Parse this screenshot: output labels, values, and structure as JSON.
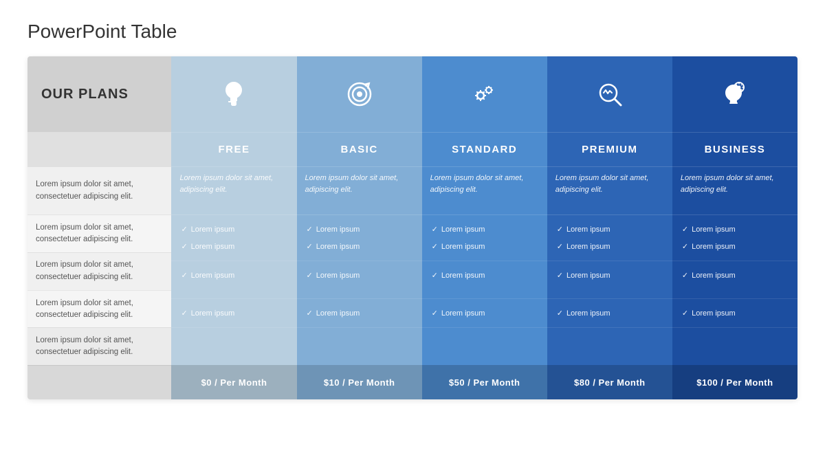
{
  "page": {
    "title": "PowerPoint Table"
  },
  "plans_label": "OUR PLANS",
  "plans": [
    {
      "id": "free",
      "name": "FREE",
      "icon": "💡",
      "icon_unicode": "💡",
      "description": "Lorem ipsum dolor sit amet, adipiscing elit.",
      "features": [
        "Lorem ipsum",
        "Lorem ipsum",
        "Lorem ipsum",
        "Lorem ipsum"
      ],
      "price": "$0 / Per Month"
    },
    {
      "id": "basic",
      "name": "BASIC",
      "icon": "🎯",
      "description": "Lorem ipsum dolor sit amet, adipiscing elit.",
      "features": [
        "Lorem ipsum",
        "Lorem ipsum",
        "Lorem ipsum",
        "Lorem ipsum"
      ],
      "price": "$10 / Per Month"
    },
    {
      "id": "standard",
      "name": "STANDARD",
      "icon": "⚙",
      "description": "Lorem ipsum dolor sit amet, adipiscing elit.",
      "features": [
        "Lorem ipsum",
        "Lorem ipsum",
        "Lorem ipsum",
        "Lorem ipsum"
      ],
      "price": "$50 / Per Month"
    },
    {
      "id": "premium",
      "name": "PREMIUM",
      "icon": "🔍",
      "description": "Lorem ipsum dolor sit amet, adipiscing elit.",
      "features": [
        "Lorem ipsum",
        "Lorem ipsum",
        "Lorem ipsum",
        "Lorem ipsum"
      ],
      "price": "$80 / Per Month"
    },
    {
      "id": "business",
      "name": "BUSINESS",
      "icon": "🧠",
      "description": "Lorem ipsum dolor sit amet, adipiscing elit.",
      "features": [
        "Lorem ipsum",
        "Lorem ipsum",
        "Lorem ipsum",
        "Lorem ipsum"
      ],
      "price": "$100 / Per Month"
    }
  ],
  "label_rows": [
    "Lorem ipsum dolor sit amet, consectetuer adipiscing elit.",
    "Lorem ipsum dolor sit amet, consectetuer adipiscing elit.",
    "Lorem ipsum dolor sit amet, consectetuer adipiscing elit.",
    "Lorem ipsum dolor sit amet, consectetuer adipiscing elit.",
    "Lorem ipsum dolor sit amet, consectetuer adipiscing elit."
  ],
  "col_colors": {
    "free": "#b0c4de",
    "basic": "#7da7d9",
    "standard": "#4a86c8",
    "premium": "#2a5fad",
    "business": "#1a4a9a"
  }
}
